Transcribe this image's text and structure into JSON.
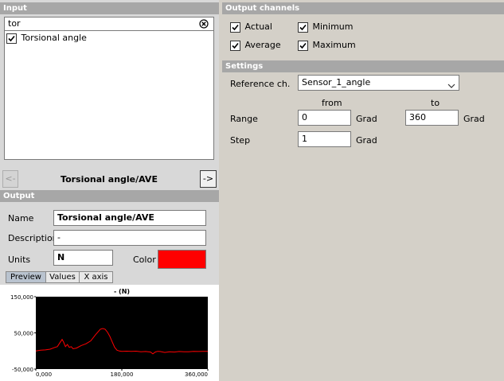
{
  "input": {
    "header": "Input",
    "search_value": "tor",
    "items": [
      {
        "label": "Torsional angle",
        "checked": true
      }
    ]
  },
  "nav": {
    "prev_label": "<-",
    "next_label": "->",
    "current_label": "Torsional angle/AVE"
  },
  "output": {
    "header": "Output",
    "name_label": "Name",
    "name_value": "Torsional angle/AVE",
    "description_label": "Description",
    "description_value": "-",
    "units_label": "Units",
    "units_value": "N",
    "color_label": "Color",
    "color_value": "#ff0000",
    "tabs": [
      {
        "label": "Preview",
        "active": true
      },
      {
        "label": "Values",
        "active": false
      },
      {
        "label": "X axis",
        "active": false
      }
    ]
  },
  "output_channels": {
    "header": "Output channels",
    "actual_label": "Actual",
    "actual_checked": true,
    "minimum_label": "Minimum",
    "minimum_checked": true,
    "average_label": "Average",
    "average_checked": true,
    "maximum_label": "Maximum",
    "maximum_checked": true
  },
  "settings": {
    "header": "Settings",
    "reference_label": "Reference ch.",
    "reference_value": "Sensor_1_angle",
    "from_label": "from",
    "to_label": "to",
    "range_label": "Range",
    "range_from": "0",
    "range_from_unit": "Grad",
    "range_to": "360",
    "range_to_unit": "Grad",
    "step_label": "Step",
    "step_value": "1",
    "step_unit": "Grad"
  },
  "chart_data": {
    "type": "line",
    "title": "- (N)",
    "ytick_labels": [
      "150,000",
      "50,000",
      "-50,000"
    ],
    "xtick_labels": [
      "0,000",
      "180,000",
      "360,000"
    ],
    "xlim": [
      0,
      360
    ],
    "ylim": [
      -50000,
      150000
    ],
    "line_color": "#ff0000",
    "background": "#000000",
    "x": [
      0,
      10,
      20,
      30,
      40,
      45,
      50,
      55,
      58,
      62,
      66,
      70,
      74,
      78,
      85,
      95,
      105,
      115,
      125,
      135,
      140,
      145,
      150,
      155,
      160,
      165,
      170,
      175,
      180,
      190,
      200,
      210,
      220,
      230,
      240,
      245,
      250,
      255,
      260,
      270,
      280,
      290,
      300,
      310,
      320,
      330,
      340,
      350,
      360
    ],
    "y": [
      0,
      2000,
      3000,
      5000,
      10000,
      12000,
      22000,
      32000,
      25000,
      12000,
      18000,
      10000,
      12000,
      6000,
      8000,
      15000,
      20000,
      28000,
      45000,
      60000,
      62000,
      60000,
      52000,
      40000,
      25000,
      10000,
      2000,
      0,
      -1000,
      -500,
      -1000,
      -500,
      -2000,
      -1500,
      -3000,
      -8000,
      -3000,
      -1000,
      -1500,
      -4000,
      -2000,
      -3000,
      -1500,
      -2000,
      -2000,
      -1000,
      -1500,
      -1000,
      -1000
    ]
  }
}
